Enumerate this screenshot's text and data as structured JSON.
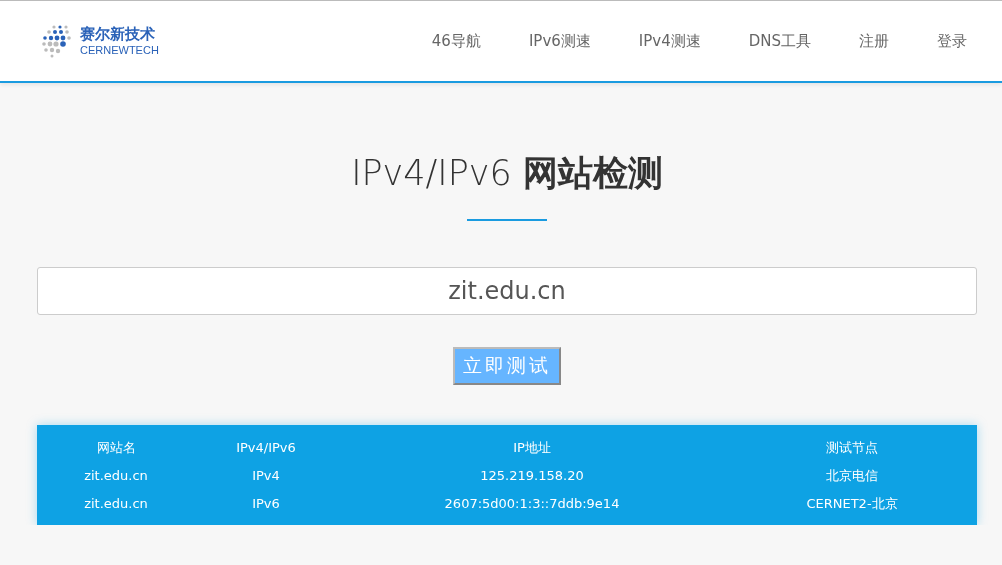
{
  "logo": {
    "name": "赛尔新技术",
    "subtitle": "CERNEWTECH"
  },
  "nav": [
    {
      "label": "46导航"
    },
    {
      "label": "IPv6测速"
    },
    {
      "label": "IPv4测速"
    },
    {
      "label": "DNS工具"
    },
    {
      "label": "注册"
    },
    {
      "label": "登录"
    }
  ],
  "title": "IPv4/IPv6 **网站检测**",
  "search": {
    "value": "zit.edu.cn"
  },
  "button": "立即测试",
  "table": {
    "columns": [
      "网站名",
      "IPv4/IPv6",
      "IP地址",
      "测试节点"
    ],
    "rows": [
      [
        "zit.edu.cn",
        "IPv4",
        "125.219.158.20",
        "北京电信"
      ],
      [
        "zit.edu.cn",
        "IPv6",
        "2607:5d00:1:3::7ddb:9e14",
        "CERNET2-北京"
      ]
    ]
  }
}
